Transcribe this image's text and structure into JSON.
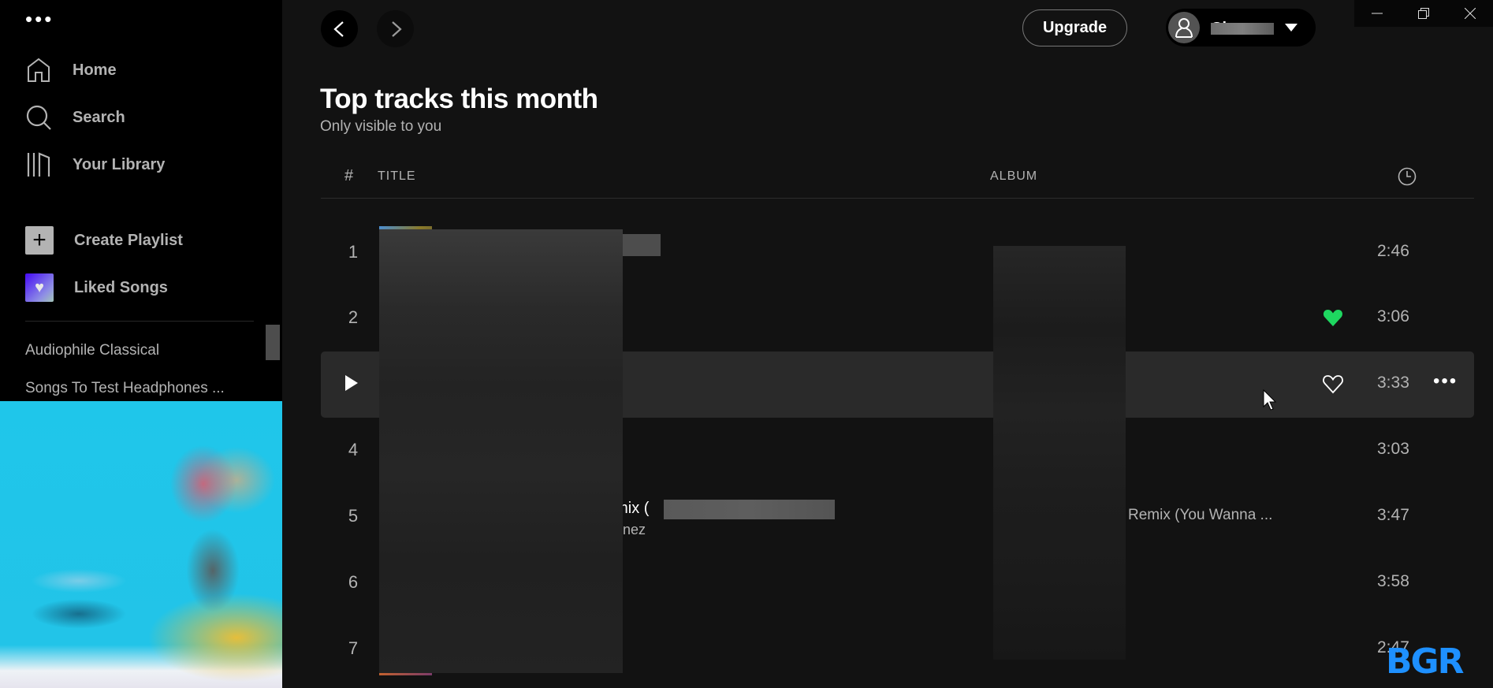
{
  "sidebar": {
    "menu_icon": "ellipsis-icon",
    "nav": [
      {
        "label": "Home",
        "icon": "home-icon"
      },
      {
        "label": "Search",
        "icon": "search-icon"
      },
      {
        "label": "Your Library",
        "icon": "library-icon"
      }
    ],
    "actions": [
      {
        "label": "Create Playlist",
        "icon": "plus-icon"
      },
      {
        "label": "Liked Songs",
        "icon": "heart-icon"
      }
    ],
    "playlists": [
      "Audiophile Classical",
      "Songs To Test Headphones ..."
    ]
  },
  "topbar": {
    "back_icon": "chevron-left-icon",
    "forward_icon": "chevron-right-icon",
    "upgrade_label": "Upgrade",
    "user_name": "Ch...",
    "window_controls": [
      "minimize",
      "restore",
      "close"
    ]
  },
  "page": {
    "title": "Top tracks this month",
    "subtitle": "Only visible to you"
  },
  "table": {
    "headers": {
      "number": "#",
      "title": "TITLE",
      "album": "ALBUM",
      "duration_icon": "clock-icon"
    },
    "rows": [
      {
        "number": "1",
        "title": "",
        "artist": "",
        "album": "",
        "liked": false,
        "duration": "2:46",
        "hovered": false
      },
      {
        "number": "2",
        "title": "",
        "artist": "",
        "album": "",
        "liked": true,
        "duration": "3:06",
        "hovered": false
      },
      {
        "number": "3",
        "title": "",
        "artist": "",
        "album": "",
        "liked": false,
        "duration": "3:33",
        "hovered": true
      },
      {
        "number": "4",
        "title": "",
        "artist": "",
        "album": "",
        "liked": false,
        "duration": "3:03",
        "hovered": false
      },
      {
        "number": "5",
        "title": "emix (",
        "artist": "nez",
        "album": "Remix (You Wanna ...",
        "liked": false,
        "duration": "3:47",
        "hovered": false
      },
      {
        "number": "6",
        "title": "",
        "artist": "",
        "album": "",
        "liked": false,
        "duration": "3:58",
        "hovered": false
      },
      {
        "number": "7",
        "title": "",
        "artist": "",
        "album": "",
        "liked": false,
        "duration": "2:47",
        "hovered": false
      }
    ]
  },
  "colors": {
    "accent_green": "#1ed760",
    "background": "#121212",
    "sidebar": "#000000",
    "hover_row": "#2a2a2a"
  },
  "watermark": "BGR"
}
